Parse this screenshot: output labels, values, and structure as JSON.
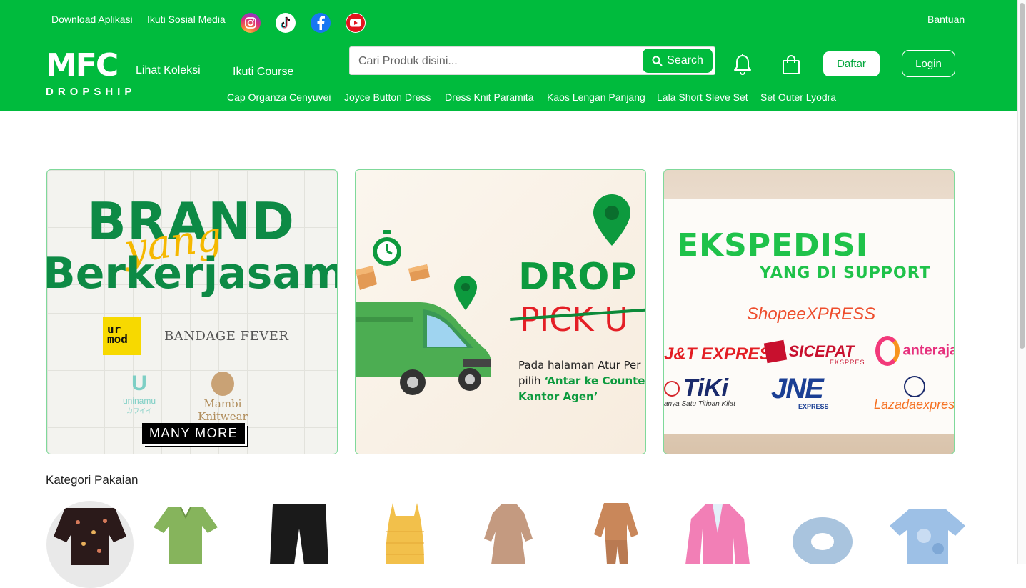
{
  "topbar": {
    "download": "Download Aplikasi",
    "social": "Ikuti Sosial Media",
    "help": "Bantuan",
    "social_icons": [
      "instagram-icon",
      "tiktok-icon",
      "facebook-icon",
      "youtube-icon"
    ]
  },
  "brand": {
    "mark": "MFC",
    "sub": "DROPSHIP"
  },
  "nav": {
    "collection": "Lihat Koleksi",
    "course": "Ikuti Course"
  },
  "search": {
    "placeholder": "Cari Produk disini...",
    "button": "Search"
  },
  "auth": {
    "register": "Daftar",
    "login": "Login"
  },
  "categories_quick": [
    "Cap Organza Cenyuvei",
    "Joyce Button Dress",
    "Dress Knit Paramita",
    "Kaos Lengan Panjang",
    "Lala Short Sleve Set",
    "Set Outer Lyodra"
  ],
  "banner1": {
    "title": "BRAND",
    "script": "yang",
    "subtitle": "Berkerjasama",
    "brands": {
      "urmod": "ur mod",
      "bandage": "BANDAGE FEVER",
      "uninamu": "uninamu",
      "uninamu_sub": "カワイイ",
      "mambi": "Mambi Knitwear"
    },
    "more": "MANY MORE"
  },
  "banner2": {
    "title": "DROP O",
    "strike": "PICK U",
    "line1": "Pada halaman Atur Per",
    "line2_prefix": "pilih ",
    "line2_green": "‘Antar ke Counter’",
    "line3": "Kantor Agen’"
  },
  "banner3": {
    "title": "EKSPEDISI",
    "subtitle": "YANG DI SUPPORT",
    "couriers": {
      "shopee": "ShopeeXPRESS",
      "jnt": "J&T EXPRESS",
      "sicepat": "SICEPAT",
      "sicepat_sub": "EKSPRES",
      "anteraja": "anteraja",
      "tiki": "TiKi",
      "tiki_sub": "anya Satu Titipan Kilat",
      "jne": "JNE",
      "jne_sub": "EXPRESS",
      "lazada": "Lazadaexpres"
    }
  },
  "section": {
    "category_title": "Kategori Pakaian"
  },
  "colors": {
    "brand_green": "#00bb3d",
    "accent_green": "#0d8a45",
    "pick_red": "#e41f26"
  }
}
